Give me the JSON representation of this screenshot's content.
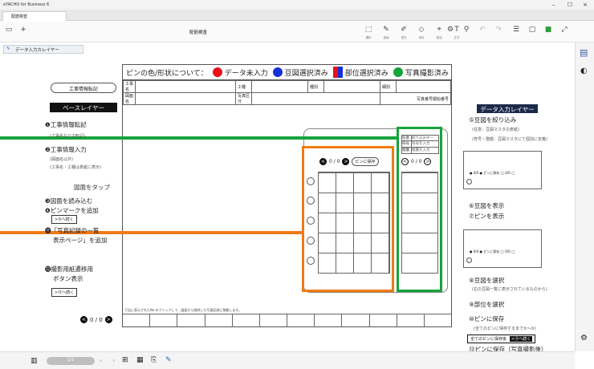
{
  "window": {
    "title": "eYACHO for Business 6",
    "minimize": "–",
    "maximize": "☐",
    "close": "×"
  },
  "tabs": [
    {
      "label": "配筋検査"
    }
  ],
  "toolbar": {
    "doc_title": "配筋検査",
    "buttons": [
      {
        "icon": "select-icon",
        "glyph": "⬚",
        "label": "選択"
      },
      {
        "icon": "pen-icon",
        "glyph": "✎",
        "label": "描画"
      },
      {
        "icon": "marker-icon",
        "glyph": "✐",
        "label": "蛍光"
      },
      {
        "icon": "eraser-icon",
        "glyph": "◇",
        "label": "消去"
      },
      {
        "icon": "pin-icon",
        "glyph": "⌖",
        "label": "部品"
      },
      {
        "icon": "text-icon",
        "glyph": "T",
        "label": "文字"
      }
    ]
  },
  "layer_button": "データ入力カレイヤー",
  "form": {
    "legend": {
      "title": "ピンの色/形状について：",
      "items": [
        {
          "label": "データ未入力",
          "color": "#e8111a",
          "shape": "circle"
        },
        {
          "label": "豆図選択済み",
          "color": "#1530d8",
          "shape": "circle"
        },
        {
          "label": "部位選択済み",
          "color": "#1530d8",
          "shape": "split"
        },
        {
          "label": "写真撮影済み",
          "color": "#17a33b",
          "shape": "circle"
        }
      ]
    },
    "row1": [
      "工事名",
      "工種",
      "種別",
      "細別"
    ],
    "row2": [
      "図面名",
      "写真区分",
      "写真番号開始番号"
    ],
    "note": "下記に表示されたNo.をクリックして、図面から削除した写真記録に移動します。",
    "nav": {
      "count": "0 / 0",
      "save": "ピンに保存"
    },
    "side_fields": [
      {
        "label": "任意",
        "value": "絞り込みキー"
      },
      {
        "label": "符号",
        "value": "符号を入力"
      },
      {
        "label": "階層",
        "value": "階層を入力"
      }
    ],
    "nav2": {
      "count": "0 / 0"
    }
  },
  "left": {
    "callout1": "工事情報転記",
    "base_layer": "ベースレイヤー",
    "step1": "❶工事情報転記",
    "step1_sub": "(工事名などの転記)",
    "step2": "❷工事情報入力",
    "step2_sub1": "(図面名以外)",
    "step2_sub2": "(工事名・工種は表紙に表示)",
    "tap": "図面をタップ",
    "step3": "❸図面を読み込む",
    "step4": "❹ピンマークを追加",
    "link1": ">⑤へ続く",
    "step11a": "⓫「写真記録の一覧",
    "step11b": "表示ページ」を追加",
    "step12a": "⓬撮影用紙遷移用",
    "step12b": "ボタン表示",
    "link2": ">⑬へ続く",
    "nav": "0 / 0"
  },
  "right": {
    "layer": "データ入力レイヤー",
    "step5": "⑤豆図を絞り込み",
    "step5_sub1": "(任意：豆図マスタの表紙)",
    "step5_sub2": "(符号・階層：豆図マスタにて個別に定義)",
    "step6": "⑥豆図を表示",
    "step7": "⑦ピンを表示",
    "step8": "⑧豆図を選択",
    "step8_sub": "(右の豆図一覧に表示されているものから)",
    "step9": "⑨部位を選択",
    "step10": "⑩ピンに保存",
    "step10_sub": "(全てのピンに保存するまで⑤〜⑩)",
    "save_all": "全てのピンに保存後",
    "link3": ">⑪へ続く",
    "step13": "⑬ピンに保存（写真撮影後）"
  },
  "page": {
    "label": "1/1"
  }
}
